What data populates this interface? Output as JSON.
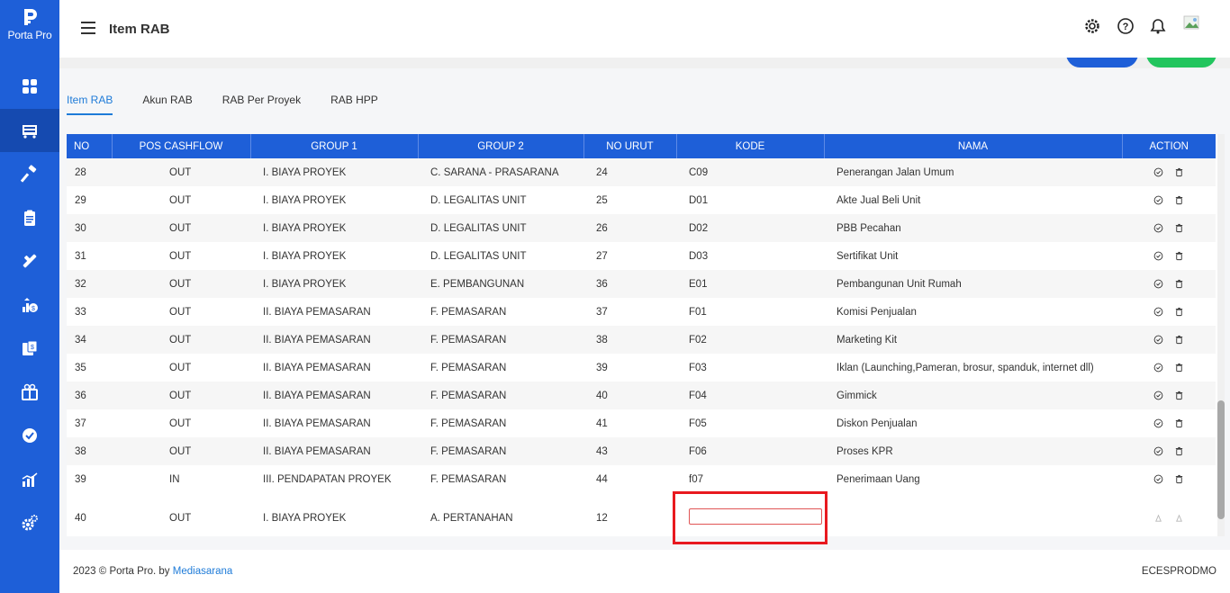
{
  "app": {
    "brand": "Porta Pro",
    "page_title": "Item RAB"
  },
  "sidebar": {
    "items": [
      {
        "icon": "dashboard-icon"
      },
      {
        "icon": "cart-icon",
        "active": true
      },
      {
        "icon": "hammer-icon"
      },
      {
        "icon": "clipboard-icon"
      },
      {
        "icon": "tools-icon"
      },
      {
        "icon": "money-chart-icon"
      },
      {
        "icon": "payment-icon"
      },
      {
        "icon": "gift-icon"
      },
      {
        "icon": "check-badge-icon"
      },
      {
        "icon": "bar-chart-icon"
      },
      {
        "icon": "settings-icon"
      }
    ]
  },
  "tabs": [
    {
      "label": "Item RAB",
      "active": true
    },
    {
      "label": "Akun RAB"
    },
    {
      "label": "RAB Per Proyek"
    },
    {
      "label": "RAB HPP"
    }
  ],
  "table": {
    "columns": [
      "NO",
      "POS CASHFLOW",
      "GROUP 1",
      "GROUP 2",
      "NO URUT",
      "KODE",
      "NAMA",
      "ACTION"
    ],
    "rows": [
      {
        "no": "28",
        "pos": "OUT",
        "g1": "I. BIAYA PROYEK",
        "g2": "C. SARANA - PRASARANA",
        "urut": "24",
        "kode": "C09",
        "nama": "Penerangan Jalan Umum"
      },
      {
        "no": "29",
        "pos": "OUT",
        "g1": "I. BIAYA PROYEK",
        "g2": "D. LEGALITAS UNIT",
        "urut": "25",
        "kode": "D01",
        "nama": "Akte Jual Beli Unit"
      },
      {
        "no": "30",
        "pos": "OUT",
        "g1": "I. BIAYA PROYEK",
        "g2": "D. LEGALITAS UNIT",
        "urut": "26",
        "kode": "D02",
        "nama": "PBB Pecahan"
      },
      {
        "no": "31",
        "pos": "OUT",
        "g1": "I. BIAYA PROYEK",
        "g2": "D. LEGALITAS UNIT",
        "urut": "27",
        "kode": "D03",
        "nama": "Sertifikat Unit"
      },
      {
        "no": "32",
        "pos": "OUT",
        "g1": "I. BIAYA PROYEK",
        "g2": "E. PEMBANGUNAN",
        "urut": "36",
        "kode": "E01",
        "nama": "Pembangunan Unit Rumah"
      },
      {
        "no": "33",
        "pos": "OUT",
        "g1": "II. BIAYA PEMASARAN",
        "g2": "F. PEMASARAN",
        "urut": "37",
        "kode": "F01",
        "nama": "Komisi Penjualan"
      },
      {
        "no": "34",
        "pos": "OUT",
        "g1": "II. BIAYA PEMASARAN",
        "g2": "F. PEMASARAN",
        "urut": "38",
        "kode": "F02",
        "nama": "Marketing Kit"
      },
      {
        "no": "35",
        "pos": "OUT",
        "g1": "II. BIAYA PEMASARAN",
        "g2": "F. PEMASARAN",
        "urut": "39",
        "kode": "F03",
        "nama": "Iklan (Launching,Pameran, brosur, spanduk, internet dll)"
      },
      {
        "no": "36",
        "pos": "OUT",
        "g1": "II. BIAYA PEMASARAN",
        "g2": "F. PEMASARAN",
        "urut": "40",
        "kode": "F04",
        "nama": "Gimmick"
      },
      {
        "no": "37",
        "pos": "OUT",
        "g1": "II. BIAYA PEMASARAN",
        "g2": "F. PEMASARAN",
        "urut": "41",
        "kode": "F05",
        "nama": "Diskon Penjualan"
      },
      {
        "no": "38",
        "pos": "OUT",
        "g1": "II. BIAYA PEMASARAN",
        "g2": "F. PEMASARAN",
        "urut": "43",
        "kode": "F06",
        "nama": "Proses KPR"
      },
      {
        "no": "39",
        "pos": "IN",
        "g1": "III. PENDAPATAN PROYEK",
        "g2": "F. PEMASARAN",
        "urut": "44",
        "kode": "f07",
        "nama": "Penerimaan Uang"
      }
    ],
    "edit_row": {
      "no": "40",
      "pos": "OUT",
      "g1": "I. BIAYA PROYEK",
      "g2": "A. PERTANAHAN",
      "urut": "12",
      "kode_value": ""
    }
  },
  "footer": {
    "copyright": "2023 © Porta Pro. by ",
    "company": "Mediasarana",
    "code": "ECESPRODMO"
  },
  "colors": {
    "primary": "#1e5fd8",
    "success": "#22c55e",
    "highlight": "#e8191f"
  }
}
